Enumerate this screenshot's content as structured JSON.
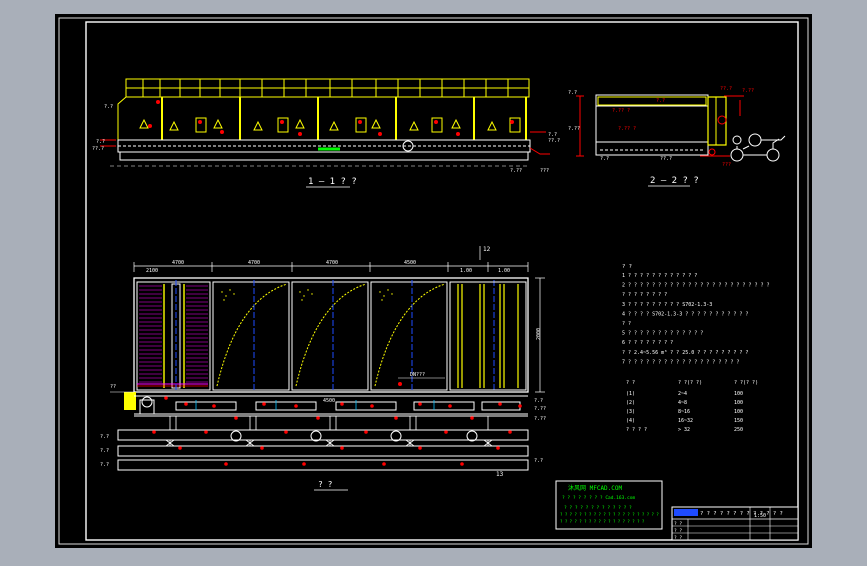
{
  "drawing": {
    "section_1_title": "1 — 1 ? ?",
    "section_2_title": "2 — 2 ? ?",
    "plan_title": "? ?",
    "dim_top_left": "2100",
    "dim_top_2": "4700",
    "dim_top_3": "4700",
    "dim_top_4": "4700",
    "dim_top_5": "4500",
    "dim_top_6": "1.00",
    "dim_top_7": "1.00",
    "dim_right": "2000",
    "dim_bottom": "4500",
    "pipe_label": "DN???",
    "label_top_right": "12",
    "label_bottom_right": "13"
  },
  "notes": {
    "heading": "? ?",
    "lines": [
      "1 ? ? ? ? ? ? ? ? ? ? ? ?",
      "2 ? ? ? ? ? ? ? ? ? ? ? ? ? ? ? ? ? ? ? ? ? ? ? ?",
      "   ? ? ? ? ? ? ? ?",
      "3 ? ? ? ? ? ? ? ? ?   S702-1.3-3",
      "4 ? ? ? ?   S702-1.3-3 ? ? ? ? ? ? ? ? ? ? ?",
      "   ? ?",
      "5 ? ? ? ? ? ? ? ? ? ? ? ? ?",
      "6 ? ? ? ? ? ? ? ?",
      "   ? ?  2.4~5.56  m³  ? ?  25.0 ? ? ? ? ? ? ? ? ?",
      "7 ? ? ? ? ? ? ?    ? ?   ? ? ? ?   ? ? ?   ? ? ?"
    ],
    "table_header": [
      "? ?",
      "? ?(? ?)",
      "? ?(? ?)"
    ],
    "table_rows": [
      [
        "(1)",
        "2~4",
        "100"
      ],
      [
        "(2)",
        "4~8",
        "100"
      ],
      [
        "(3)",
        "8~16",
        "100"
      ],
      [
        "(4)",
        "16~32",
        "150"
      ],
      [
        "? ? ? ?",
        "> 32",
        "250"
      ]
    ]
  },
  "watermark": {
    "brand": "沐风网 MFCAD.COM",
    "line1": "? ? ? ? ? ? ? ?     Cad.163.com",
    "line2": "? ? ? ? ? ? ? ? ? ? ? ? ?",
    "line3": "? ? ? ? ? ? ? ? ? ? ? ? ? ? ? ? ? ? ? ? ?",
    "line4": "? ? ? ? ? ? ? ? ? ? ? ? ? ? ? ? ? ?"
  },
  "title_block": {
    "title": "? ? ? ? ? ? ? ? ? ? ? ? ?",
    "scale": "1:50",
    "rows": [
      "? ?",
      "? ?",
      "? ?"
    ]
  },
  "colors": {
    "sheet_bg": "#000000",
    "background": "#a9afb9",
    "cad_white": "#ffffff",
    "cad_yellow": "#ffff00",
    "cad_red": "#ff0000",
    "cad_blue": "#1e4bff",
    "cad_magenta": "#ff00ff",
    "cad_green": "#00ff00",
    "cad_cyan": "#00c0ff"
  }
}
